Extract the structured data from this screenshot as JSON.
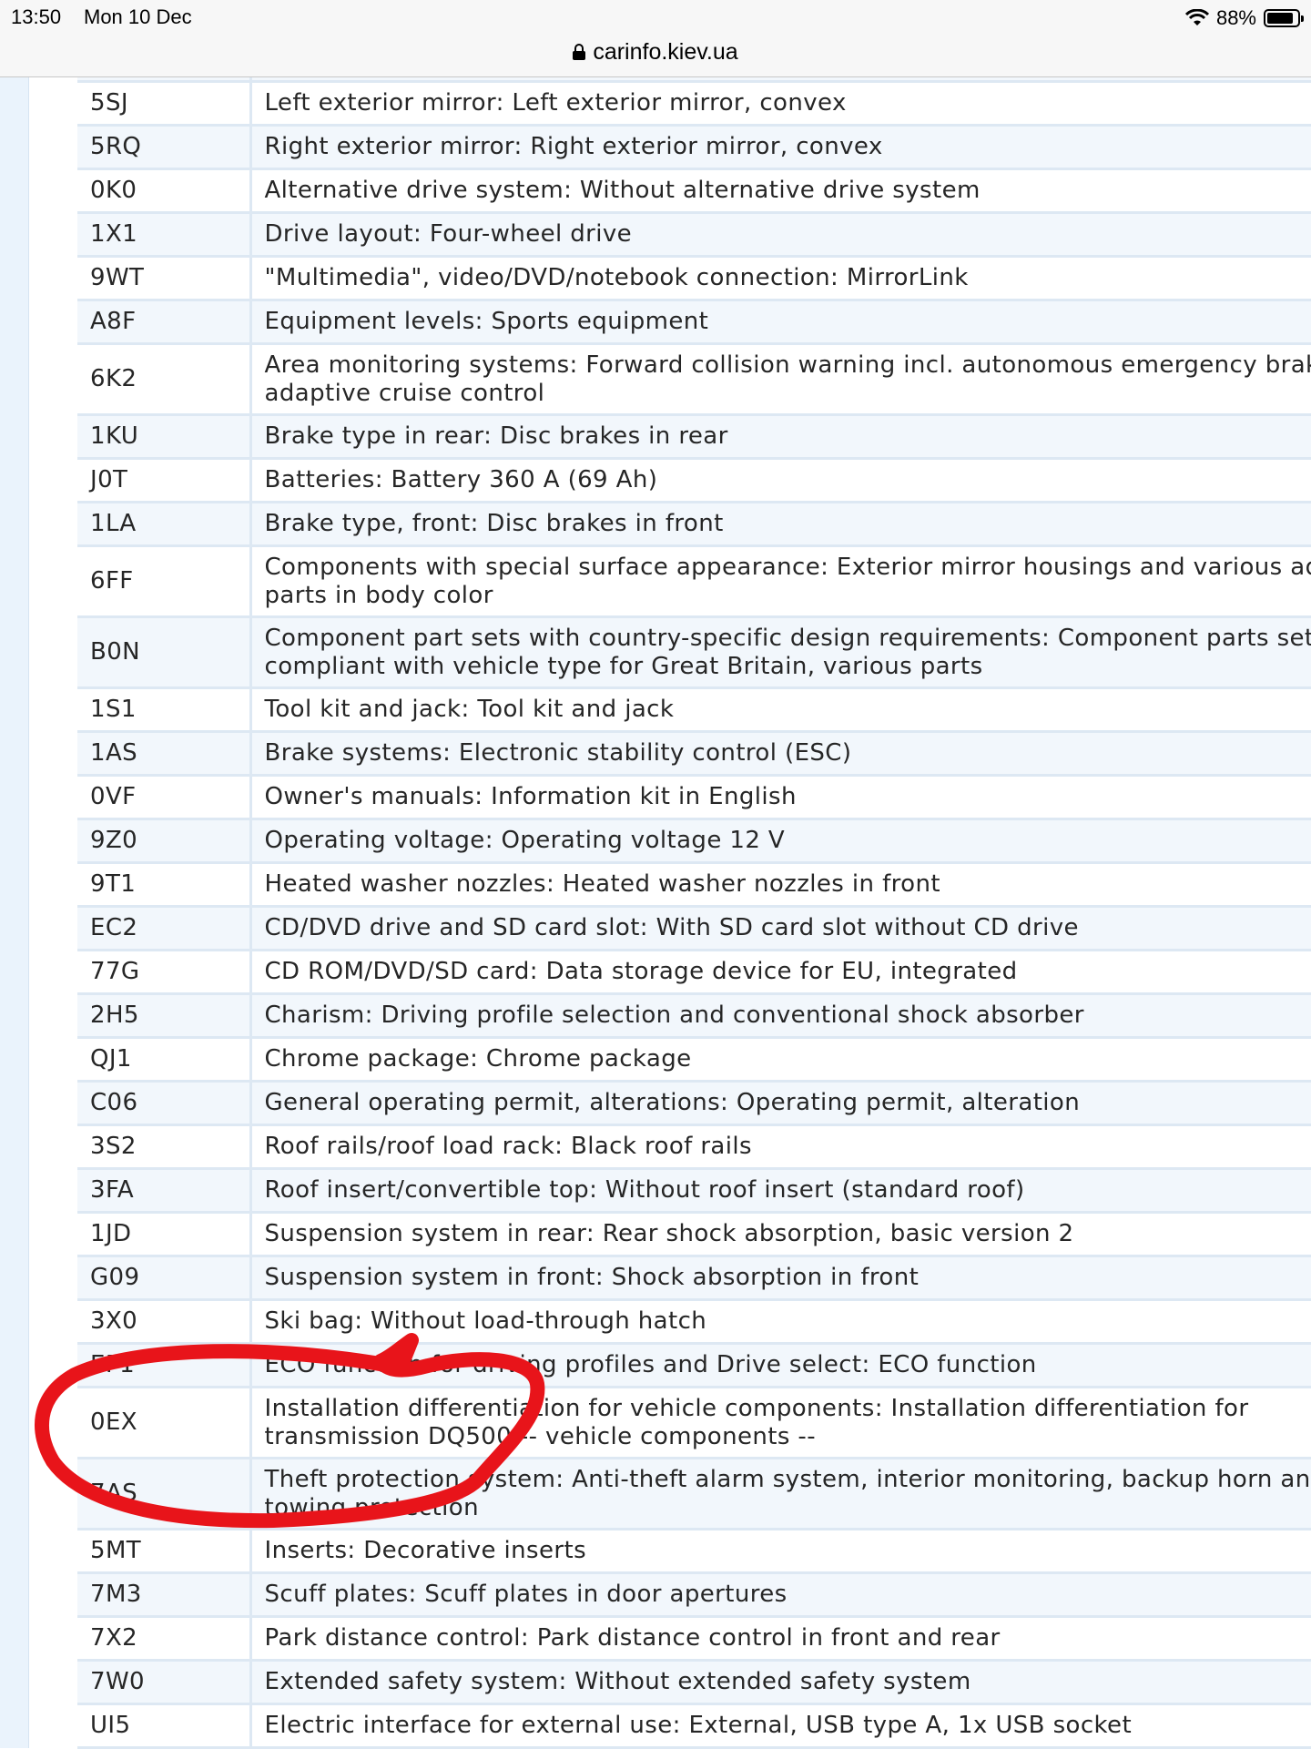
{
  "status_bar": {
    "time": "13:50",
    "date": "Mon 10 Dec",
    "battery": "88%",
    "battery_level": 0.88
  },
  "browser": {
    "url": "carinfo.kiev.ua"
  },
  "table": {
    "rows": [
      {
        "code": "",
        "desc": ""
      },
      {
        "code": "5SJ",
        "desc": "Left exterior mirror: Left exterior mirror, convex"
      },
      {
        "code": "5RQ",
        "desc": "Right exterior mirror: Right exterior mirror, convex"
      },
      {
        "code": "0K0",
        "desc": "Alternative drive system: Without alternative drive system"
      },
      {
        "code": "1X1",
        "desc": "Drive layout: Four-wheel drive"
      },
      {
        "code": "9WT",
        "desc": "\"Multimedia\", video/DVD/notebook connection: MirrorLink"
      },
      {
        "code": "A8F",
        "desc": "Equipment levels: Sports equipment"
      },
      {
        "code": "6K2",
        "desc": "Area monitoring systems: Forward collision warning incl. autonomous emergency braking adaptive cruise control"
      },
      {
        "code": "1KU",
        "desc": "Brake type in rear: Disc brakes in rear"
      },
      {
        "code": "J0T",
        "desc": "Batteries: Battery 360 A (69 Ah)"
      },
      {
        "code": "1LA",
        "desc": "Brake type, front: Disc brakes in front"
      },
      {
        "code": "6FF",
        "desc": "Components with special surface appearance: Exterior mirror housings and various add-on parts in body color"
      },
      {
        "code": "B0N",
        "desc": "Component part sets with country-specific design requirements: Component parts set, compliant with vehicle type for Great Britain, various parts"
      },
      {
        "code": "1S1",
        "desc": "Tool kit and jack: Tool kit and jack"
      },
      {
        "code": "1AS",
        "desc": "Brake systems: Electronic stability control (ESC)"
      },
      {
        "code": "0VF",
        "desc": "Owner's manuals: Information kit in English"
      },
      {
        "code": "9Z0",
        "desc": "Operating voltage: Operating voltage 12 V"
      },
      {
        "code": "9T1",
        "desc": "Heated washer nozzles: Heated washer nozzles in front"
      },
      {
        "code": "EC2",
        "desc": "CD/DVD drive and SD card slot: With SD card slot without CD drive"
      },
      {
        "code": "77G",
        "desc": "CD ROM/DVD/SD card: Data storage device for EU, integrated"
      },
      {
        "code": "2H5",
        "desc": "Charism: Driving profile selection and conventional shock absorber"
      },
      {
        "code": "QJ1",
        "desc": "Chrome package: Chrome package"
      },
      {
        "code": "C06",
        "desc": "General operating permit, alterations: Operating permit, alteration"
      },
      {
        "code": "3S2",
        "desc": "Roof rails/roof load rack: Black roof rails"
      },
      {
        "code": "3FA",
        "desc": "Roof insert/convertible top: Without roof insert (standard roof)"
      },
      {
        "code": "1JD",
        "desc": "Suspension system in rear: Rear shock absorption, basic version 2"
      },
      {
        "code": "G09",
        "desc": "Suspension system in front: Shock absorption in front"
      },
      {
        "code": "3X0",
        "desc": "Ski bag: Without load-through hatch"
      },
      {
        "code": "EF1",
        "desc": "ECO function for driving profiles and Drive select: ECO function"
      },
      {
        "code": "0EX",
        "desc": "Installation differentiation for vehicle components: Installation differentiation for transmission DQ500 -- vehicle components --"
      },
      {
        "code": "7AS",
        "desc": "Theft protection system: Anti-theft alarm system, interior monitoring, backup horn and towing protection"
      },
      {
        "code": "5MT",
        "desc": "Inserts: Decorative inserts"
      },
      {
        "code": "7M3",
        "desc": "Scuff plates: Scuff plates in door apertures"
      },
      {
        "code": "7X2",
        "desc": "Park distance control: Park distance control in front and rear"
      },
      {
        "code": "7W0",
        "desc": "Extended safety system: Without extended safety system"
      },
      {
        "code": "UI5",
        "desc": "Electric interface for external use: External, USB type A, 1x USB socket"
      }
    ]
  },
  "annotation": {
    "color": "#e8141a",
    "target_code": "0EX"
  }
}
